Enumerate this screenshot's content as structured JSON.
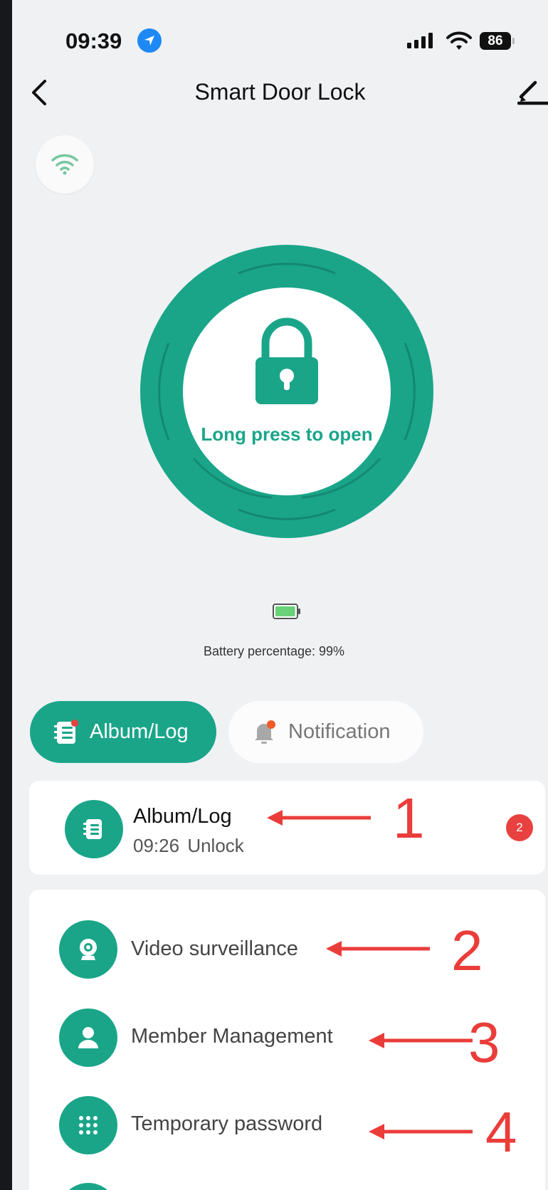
{
  "status_bar": {
    "time": "09:39",
    "battery_level": "86",
    "icons": [
      "location-arrow-icon",
      "cellular-signal-icon",
      "wifi-icon",
      "battery-icon"
    ]
  },
  "header": {
    "title": "Smart Door Lock",
    "back_icon": "chevron-left-icon",
    "edit_icon": "pencil-icon"
  },
  "connection": {
    "icon": "wifi-icon",
    "color": "#76c7a2"
  },
  "lock": {
    "label": "Long press to open",
    "icon": "padlock-icon",
    "ring_color": "#1aa589"
  },
  "battery": {
    "label": "Battery percentage: 99%",
    "level_fraction": 0.99,
    "icon": "battery-icon"
  },
  "tabs": [
    {
      "label": "Album/Log",
      "icon": "log-list-icon",
      "active": true
    },
    {
      "label": "Notification",
      "icon": "bell-icon",
      "active": false
    }
  ],
  "log_card": {
    "title": "Album/Log",
    "time": "09:26",
    "event": "Unlock",
    "badge": "2",
    "icon": "log-list-icon"
  },
  "menu": [
    {
      "label": "Video surveillance",
      "icon": "webcam-icon"
    },
    {
      "label": "Member Management",
      "icon": "person-icon"
    },
    {
      "label": "Temporary password",
      "icon": "keypad-icon"
    }
  ],
  "annotations": [
    "1",
    "2",
    "3",
    "4"
  ],
  "colors": {
    "accent": "#1aa589",
    "annotation": "#ea3d3a",
    "badge": "#e8413f",
    "background": "#f0f1f3"
  }
}
